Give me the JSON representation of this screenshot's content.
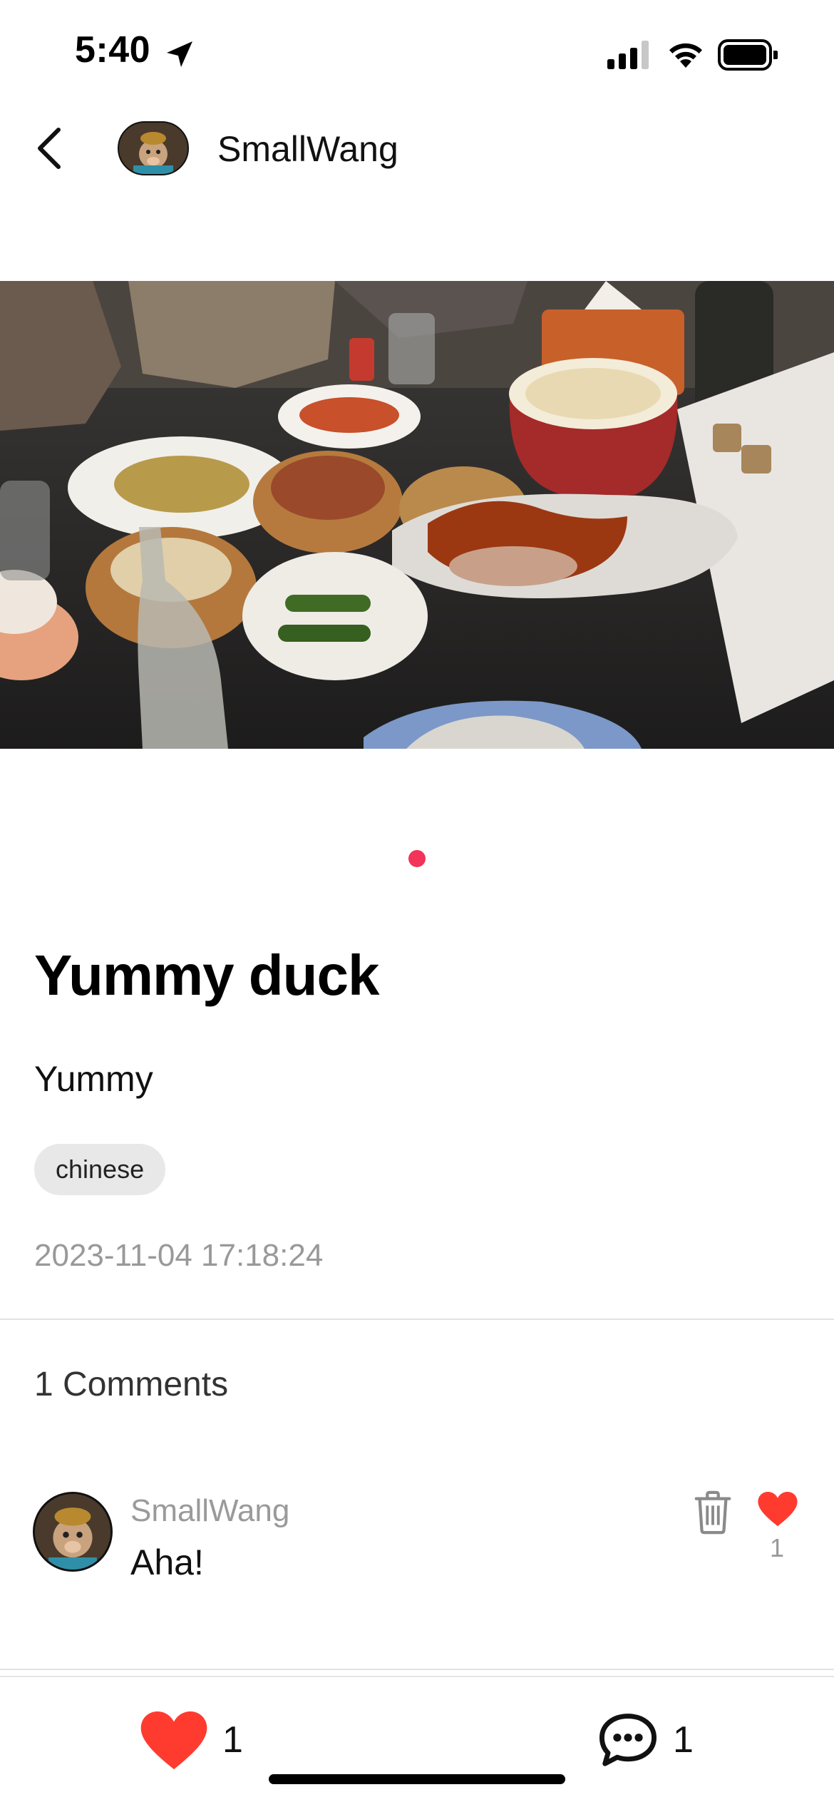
{
  "status_bar": {
    "time": "5:40"
  },
  "header": {
    "username": "SmallWang"
  },
  "post": {
    "title": "Yummy duck",
    "body": "Yummy",
    "tag": "chinese",
    "timestamp": "2023-11-04 17:18:24"
  },
  "comments": {
    "count_label": "1 Comments",
    "items": [
      {
        "username": "SmallWang",
        "text": "Aha!",
        "likes": "1"
      }
    ]
  },
  "bottom_bar": {
    "like_count": "1",
    "comment_count": "1"
  },
  "colors": {
    "accent": "#f2335a",
    "like": "#ff3b30",
    "muted_text": "#999999"
  }
}
